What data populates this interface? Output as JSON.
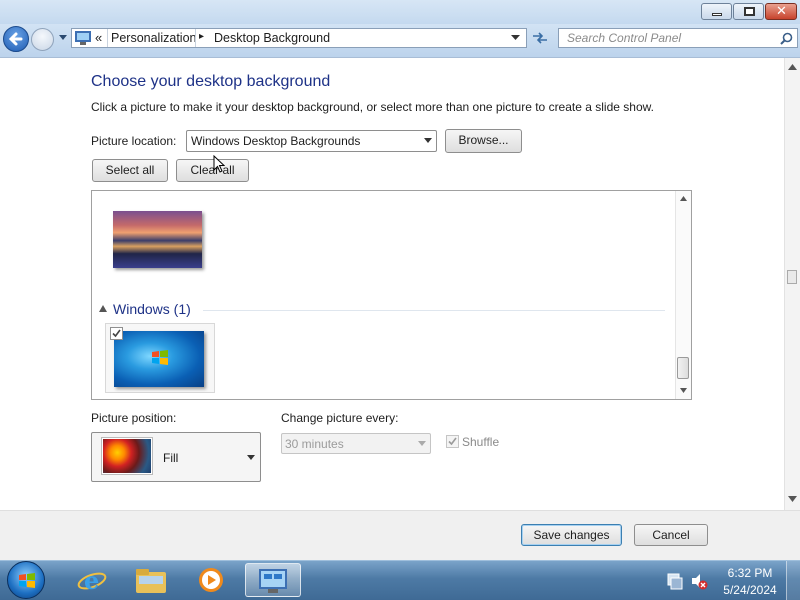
{
  "window": {
    "controls": {
      "minimize": "minimize",
      "maximize": "maximize",
      "close": "close"
    }
  },
  "address": {
    "chevron": "«",
    "crumb_1": "Personalization",
    "separator": "▸",
    "crumb_2": "Desktop Background"
  },
  "search": {
    "placeholder": "Search Control Panel"
  },
  "main": {
    "heading": "Choose your desktop background",
    "description": "Click a picture to make it your desktop background, or select more than one picture to create a slide show.",
    "location_label": "Picture location:",
    "location_value": "Windows Desktop Backgrounds",
    "browse_label": "Browse...",
    "select_all_label": "Select all",
    "clear_all_label": "Clear all",
    "group_title": "Windows (1)",
    "position_label": "Picture position:",
    "position_value": "Fill",
    "change_label": "Change picture every:",
    "change_value": "30 minutes",
    "shuffle_label": "Shuffle",
    "shuffle_checked": true,
    "windows_wallpaper_checked": true
  },
  "footer": {
    "save_label": "Save changes",
    "cancel_label": "Cancel"
  },
  "taskbar": {
    "time": "6:32 PM",
    "date": "5/24/2024",
    "items": [
      "start-orb",
      "internet-explorer",
      "windows-explorer",
      "media-player",
      "control-panel"
    ]
  }
}
